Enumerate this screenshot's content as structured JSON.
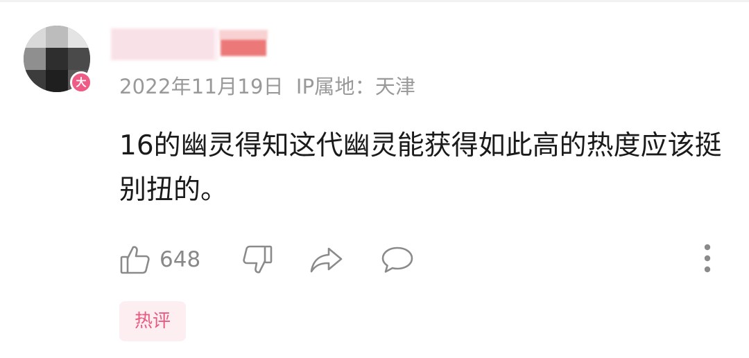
{
  "comment": {
    "author": {
      "name": "",
      "level_badge": "大"
    },
    "date": "2022年11月19日",
    "ip_location_label": "IP属地：",
    "ip_location": "天津",
    "text": "16的幽灵得知这代幽灵能获得如此高的热度应该挺别扭的。",
    "actions": {
      "like_icon": "thumbs-up-icon",
      "like_count": "648",
      "dislike_icon": "thumbs-down-icon",
      "share_icon": "share-icon",
      "reply_icon": "comment-bubble-icon",
      "more_icon": "more-vertical-icon"
    },
    "tag": "热评"
  },
  "colors": {
    "meta_gray": "#999999",
    "text": "#1a1a1a",
    "icon_gray": "#8a8a8a",
    "badge_pink": "#ee5c86",
    "tag_bg": "#fdeef2",
    "tag_text": "#e85a80"
  }
}
